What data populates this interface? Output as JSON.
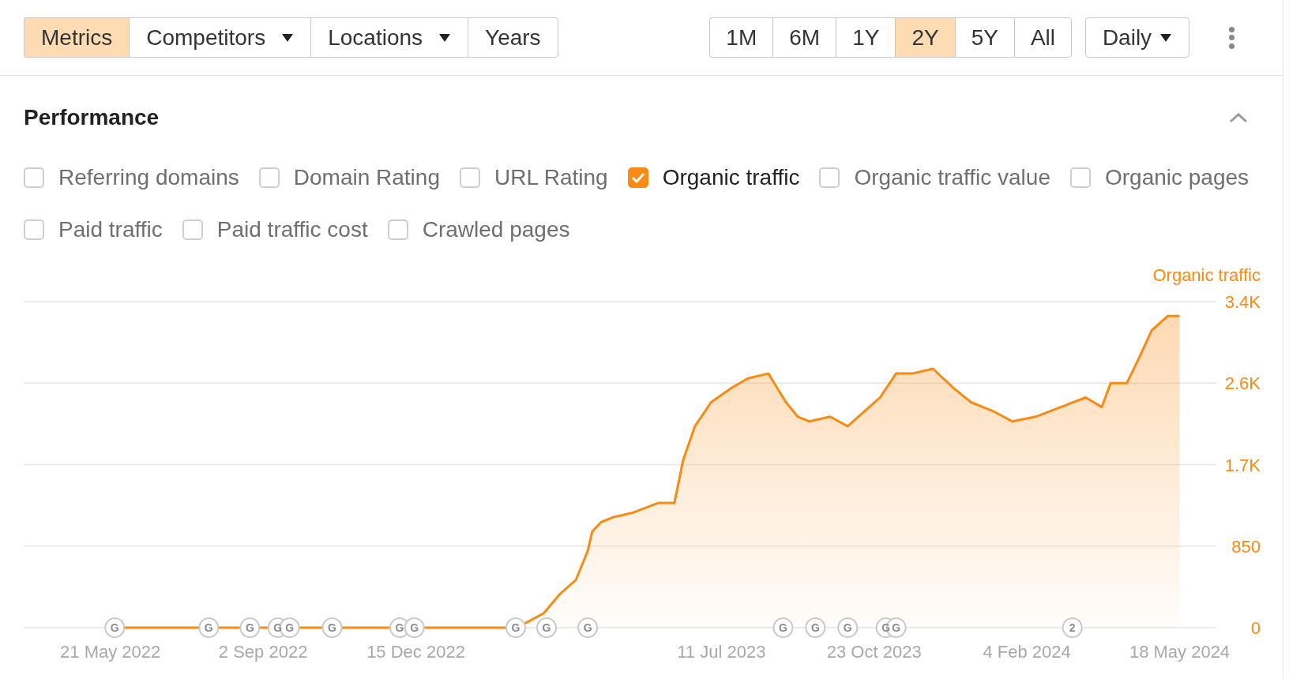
{
  "toolbar": {
    "view_tabs": [
      {
        "label": "Metrics",
        "selected": true,
        "dropdown": false
      },
      {
        "label": "Competitors",
        "selected": false,
        "dropdown": true
      },
      {
        "label": "Locations",
        "selected": false,
        "dropdown": true
      },
      {
        "label": "Years",
        "selected": false,
        "dropdown": false
      }
    ],
    "ranges": [
      {
        "label": "1M",
        "selected": false
      },
      {
        "label": "6M",
        "selected": false
      },
      {
        "label": "1Y",
        "selected": false
      },
      {
        "label": "2Y",
        "selected": true
      },
      {
        "label": "5Y",
        "selected": false
      },
      {
        "label": "All",
        "selected": false
      }
    ],
    "interval": {
      "label": "Daily"
    }
  },
  "performance": {
    "title": "Performance",
    "expanded": true,
    "metrics": [
      {
        "label": "Referring domains",
        "checked": false
      },
      {
        "label": "Domain Rating",
        "checked": false
      },
      {
        "label": "URL Rating",
        "checked": false
      },
      {
        "label": "Organic traffic",
        "checked": true
      },
      {
        "label": "Organic traffic value",
        "checked": false
      },
      {
        "label": "Organic pages",
        "checked": false
      },
      {
        "label": "Paid traffic",
        "checked": false
      },
      {
        "label": "Paid traffic cost",
        "checked": false
      },
      {
        "label": "Crawled pages",
        "checked": false
      }
    ],
    "chart_data": {
      "type": "area",
      "series": [
        {
          "name": "Organic traffic",
          "color": "#f98a14",
          "values": [
            0,
            0,
            0,
            50,
            150,
            350,
            500,
            800,
            1000,
            1100,
            1150,
            1200,
            1300,
            1300,
            1750,
            2100,
            2350,
            2500,
            2600,
            2650,
            2350,
            2200,
            2150,
            2200,
            2100,
            2250,
            2400,
            2650,
            2650,
            2700,
            2500,
            2350,
            2250,
            2150,
            2200,
            2300,
            2400,
            2300,
            2550,
            2550,
            2800,
            3100,
            3250,
            3250
          ]
        }
      ],
      "xlim": [
        "2022-03-23",
        "2024-06-12"
      ],
      "grid": true,
      "x": [
        "2022-05-24",
        "2022-10-17",
        "2023-02-21",
        "2023-02-28",
        "2023-03-12",
        "2023-03-23",
        "2023-04-03",
        "2023-04-11",
        "2023-04-14",
        "2023-04-20",
        "2023-04-28",
        "2023-05-12",
        "2023-05-29",
        "2023-06-09",
        "2023-06-15",
        "2023-06-23",
        "2023-07-04",
        "2023-07-18",
        "2023-07-29",
        "2023-08-12",
        "2023-08-24",
        "2023-09-01",
        "2023-09-09",
        "2023-09-23",
        "2023-10-05",
        "2023-10-16",
        "2023-10-27",
        "2023-11-07",
        "2023-11-18",
        "2023-12-02",
        "2023-12-16",
        "2023-12-28",
        "2024-01-13",
        "2024-01-25",
        "2024-02-10",
        "2024-02-27",
        "2024-03-15",
        "2024-03-26",
        "2024-04-01",
        "2024-04-12",
        "2024-04-20",
        "2024-04-29",
        "2024-05-10",
        "2024-05-18"
      ],
      "ylim": [
        0,
        3400
      ],
      "yticks": [
        {
          "value": 0,
          "label": "0"
        },
        {
          "value": 850,
          "label": "850"
        },
        {
          "value": 1700,
          "label": "1.7K"
        },
        {
          "value": 2550,
          "label": "2.6K"
        },
        {
          "value": 3400,
          "label": "3.4K"
        }
      ],
      "xticks": [
        {
          "value": "2022-05-21",
          "label": "21 May 2022"
        },
        {
          "value": "2022-09-02",
          "label": "2 Sep 2022"
        },
        {
          "value": "2022-12-15",
          "label": "15 Dec 2022"
        },
        {
          "value": "2023-07-11",
          "label": "11 Jul 2023"
        },
        {
          "value": "2023-10-23",
          "label": "23 Oct 2023"
        },
        {
          "value": "2024-02-04",
          "label": "4 Feb 2024"
        },
        {
          "value": "2024-05-18",
          "label": "18 May 2024"
        }
      ],
      "annotations": [
        {
          "x": "2022-05-24",
          "text": "G"
        },
        {
          "x": "2022-07-27",
          "text": "G"
        },
        {
          "x": "2022-08-24",
          "text": "G"
        },
        {
          "x": "2022-09-12",
          "text": "G"
        },
        {
          "x": "2022-09-20",
          "text": "G"
        },
        {
          "x": "2022-10-19",
          "text": "G"
        },
        {
          "x": "2022-12-04",
          "text": "G"
        },
        {
          "x": "2022-12-14",
          "text": "G"
        },
        {
          "x": "2023-02-21",
          "text": "G"
        },
        {
          "x": "2023-03-14",
          "text": "G"
        },
        {
          "x": "2023-04-11",
          "text": "G"
        },
        {
          "x": "2023-08-22",
          "text": "G"
        },
        {
          "x": "2023-09-13",
          "text": "G"
        },
        {
          "x": "2023-10-05",
          "text": "G"
        },
        {
          "x": "2023-10-31",
          "text": "G"
        },
        {
          "x": "2023-11-07",
          "text": "G"
        },
        {
          "x": "2024-03-06",
          "text": "2"
        }
      ]
    }
  }
}
